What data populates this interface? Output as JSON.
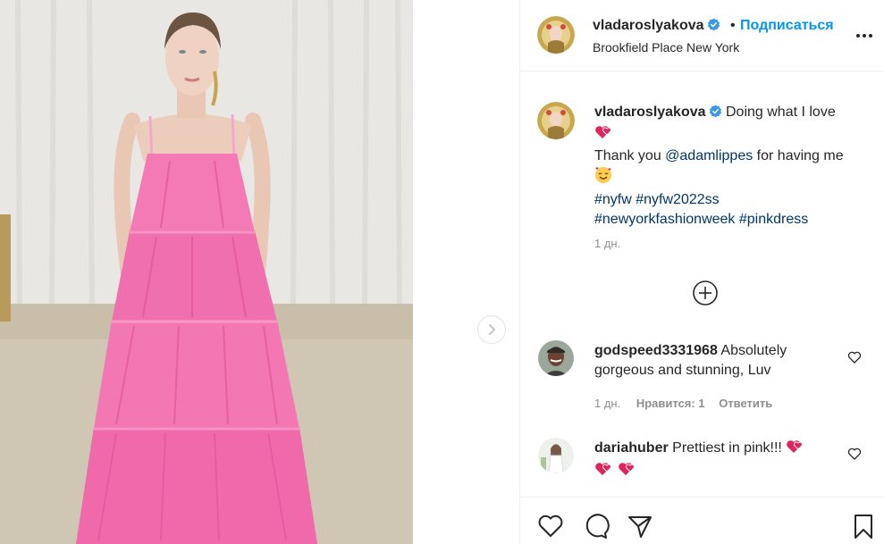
{
  "post": {
    "username": "vladaroslyakova",
    "dot": "•",
    "follow_label": "Подписаться",
    "location": "Brookfield Place New York",
    "caption": {
      "username": "vladaroslyakova",
      "text_1": "Doing what I love",
      "text_2": "Thank you ",
      "mention": "@adamlippes",
      "text_3": " for having me",
      "hashtags": [
        "#nyfw",
        "#nyfw2022ss",
        "#newyorkfashionweek",
        "#pinkdress"
      ],
      "time": "1 дн."
    }
  },
  "comments": [
    {
      "username": "godspeed3331968",
      "text": "Absolutely gorgeous and stunning, Luv",
      "time": "1 дн.",
      "likes": "Нравится: 1",
      "reply": "Ответить"
    },
    {
      "username": "dariahuber",
      "text": "Prettiest in pink!!!"
    }
  ],
  "icons": {
    "verified": "verified-badge-icon",
    "more": "more-options-icon",
    "next": "chevron-right-icon",
    "load_more": "plus-circle-icon",
    "like": "heart-outline-icon",
    "comment": "comment-icon",
    "share": "paper-plane-icon",
    "save": "bookmark-icon"
  },
  "colors": {
    "accent": "#0095f6",
    "link": "#00376b",
    "muted": "#8e8e8e",
    "verified": "#3897f0",
    "dress": "#f47ab6",
    "heart_emoji": "#e0245e"
  }
}
